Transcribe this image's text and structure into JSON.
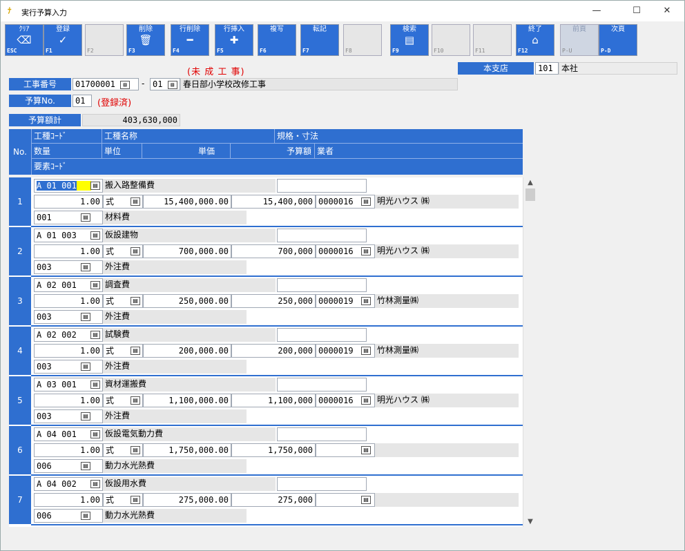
{
  "window": {
    "title": "実行予算入力",
    "app_icon": "app-logo-icon",
    "minimize": "—",
    "maximize": "☐",
    "close": "✕"
  },
  "toolbar": [
    {
      "label": "ｸﾘｱ",
      "key": "ESC",
      "icon": "clear-icon",
      "glyph": "⌫",
      "state": "on"
    },
    {
      "label": "登録",
      "key": "F1",
      "icon": "check-icon",
      "glyph": "✓",
      "state": "on"
    },
    {
      "label": "",
      "key": "F2",
      "icon": "",
      "glyph": "",
      "state": "empty"
    },
    {
      "label": "削除",
      "key": "F3",
      "icon": "trash-icon",
      "glyph": "🗑",
      "state": "on"
    },
    {
      "label": "行削除",
      "key": "F4",
      "icon": "minus-icon",
      "glyph": "━",
      "state": "on"
    },
    {
      "label": "行挿入",
      "key": "F5",
      "icon": "plus-icon",
      "glyph": "✚",
      "state": "on"
    },
    {
      "label": "複写",
      "key": "F6",
      "icon": "",
      "glyph": "",
      "state": "on"
    },
    {
      "label": "転記",
      "key": "F7",
      "icon": "",
      "glyph": "",
      "state": "on"
    },
    {
      "label": "",
      "key": "F8",
      "icon": "",
      "glyph": "",
      "state": "empty"
    },
    {
      "label": "検索",
      "key": "F9",
      "icon": "search-doc-icon",
      "glyph": "▤",
      "state": "on"
    },
    {
      "label": "",
      "key": "F10",
      "icon": "",
      "glyph": "",
      "state": "empty"
    },
    {
      "label": "",
      "key": "F11",
      "icon": "",
      "glyph": "",
      "state": "empty"
    },
    {
      "label": "終了",
      "key": "F12",
      "icon": "home-icon",
      "glyph": "⌂",
      "state": "on"
    },
    {
      "label": "前頁",
      "key": "P-U",
      "icon": "",
      "glyph": "",
      "state": "dis"
    },
    {
      "label": "次頁",
      "key": "P-D",
      "icon": "",
      "glyph": "",
      "state": "on"
    }
  ],
  "header": {
    "status": "(未 成 工 事)",
    "branch_label": "本支店",
    "branch_code": "101",
    "branch_name": "本社",
    "job_label": "工事番号",
    "job_no": "01700001",
    "dash": "-",
    "job_sub": "01",
    "job_name": "春日部小学校改修工事",
    "budget_no_label": "予算No.",
    "budget_no": "01",
    "registered": "(登録済)",
    "total_label": "予算額計",
    "total_value": "403,630,000"
  },
  "grid_header": {
    "no": "No.",
    "work_code": "工種ｺｰﾄﾞ",
    "work_name": "工種名称",
    "spec": "規格・寸法",
    "qty": "数量",
    "unit": "単位",
    "unit_price": "単価",
    "budget_amt": "予算額",
    "vendor": "業者",
    "element_code": "要素ｺｰﾄﾞ"
  },
  "rows": [
    {
      "no": "1",
      "code": "A 01 001",
      "name": "搬入路整備費",
      "spec": "",
      "qty": "1.00",
      "unit": "式",
      "price": "15,400,000.00",
      "amount": "15,400,000",
      "vendor_code": "0000016",
      "vendor_name": "明光ハウス ㈱",
      "elem_code": "001",
      "elem_name": "材料費"
    },
    {
      "no": "2",
      "code": "A 01 003",
      "name": "仮設建物",
      "spec": "",
      "qty": "1.00",
      "unit": "式",
      "price": "700,000.00",
      "amount": "700,000",
      "vendor_code": "0000016",
      "vendor_name": "明光ハウス ㈱",
      "elem_code": "003",
      "elem_name": "外注費"
    },
    {
      "no": "3",
      "code": "A 02 001",
      "name": "調査費",
      "spec": "",
      "qty": "1.00",
      "unit": "式",
      "price": "250,000.00",
      "amount": "250,000",
      "vendor_code": "0000019",
      "vendor_name": "竹林測量㈱",
      "elem_code": "003",
      "elem_name": "外注費"
    },
    {
      "no": "4",
      "code": "A 02 002",
      "name": "試験費",
      "spec": "",
      "qty": "1.00",
      "unit": "式",
      "price": "200,000.00",
      "amount": "200,000",
      "vendor_code": "0000019",
      "vendor_name": "竹林測量㈱",
      "elem_code": "003",
      "elem_name": "外注費"
    },
    {
      "no": "5",
      "code": "A 03 001",
      "name": "資材運搬費",
      "spec": "",
      "qty": "1.00",
      "unit": "式",
      "price": "1,100,000.00",
      "amount": "1,100,000",
      "vendor_code": "0000016",
      "vendor_name": "明光ハウス ㈱",
      "elem_code": "003",
      "elem_name": "外注費"
    },
    {
      "no": "6",
      "code": "A 04 001",
      "name": "仮設電気動力費",
      "spec": "",
      "qty": "1.00",
      "unit": "式",
      "price": "1,750,000.00",
      "amount": "1,750,000",
      "vendor_code": "",
      "vendor_name": "",
      "elem_code": "006",
      "elem_name": "動力水光熱費"
    },
    {
      "no": "7",
      "code": "A 04 002",
      "name": "仮設用水費",
      "spec": "",
      "qty": "1.00",
      "unit": "式",
      "price": "275,000.00",
      "amount": "275,000",
      "vendor_code": "",
      "vendor_name": "",
      "elem_code": "006",
      "elem_name": "動力水光熱費"
    }
  ],
  "scroll": {
    "up": "▲",
    "down": "▼"
  },
  "colors": {
    "accent": "#2f6fd0",
    "warning": "#e00000",
    "highlight": "#ffff00"
  }
}
